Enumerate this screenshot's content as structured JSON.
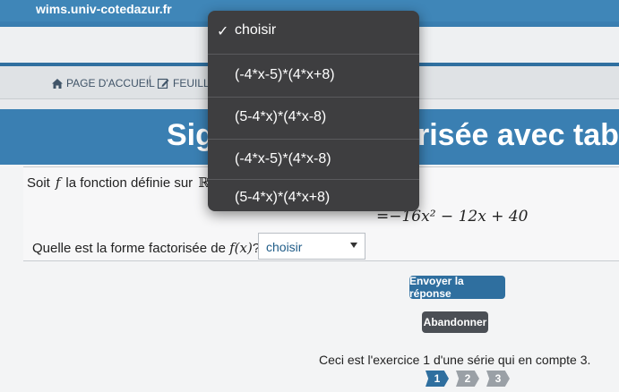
{
  "browser": {
    "url": "wims.univ-cotedazur.fr"
  },
  "breadcrumb": {
    "home_label": "PAGE D'ACCUEIL",
    "sheet_label": "FEUILLE"
  },
  "page": {
    "title_left": "Sig",
    "title_right": "risée avec table"
  },
  "exercise": {
    "intro": "Soit",
    "function_symbol": "f",
    "intro_rest": "la fonction définie sur",
    "domain_symbol": "ℝ",
    "formula_visible": "=−16x² − 12x + 40",
    "question_prefix": "Quelle est la forme factorisée de ",
    "question_fx": "f(x)",
    "question_suffix": "?",
    "select_value": "choisir"
  },
  "actions": {
    "submit_label": "Envoyer la réponse",
    "abandon_label": "Abandonner"
  },
  "status": {
    "info_text": "Ceci est l'exercice 1 d'une série qui en compte 3."
  },
  "steps": [
    "1",
    "2",
    "3"
  ],
  "dropdown": {
    "options": [
      {
        "label": "choisir",
        "selected": true
      },
      {
        "label": "(-4*x-5)*(4*x+8)",
        "selected": false
      },
      {
        "label": "(5-4*x)*(4*x-8)",
        "selected": false
      },
      {
        "label": "(-4*x-5)*(4*x-8)",
        "selected": false
      },
      {
        "label": "(5-4*x)*(4*x+8)",
        "selected": false
      }
    ]
  },
  "colors": {
    "brand": "#3a7fb2",
    "button": "#2f6f9f",
    "abandon": "#4b4f55",
    "dropdown_bg": "#3e3e40"
  }
}
